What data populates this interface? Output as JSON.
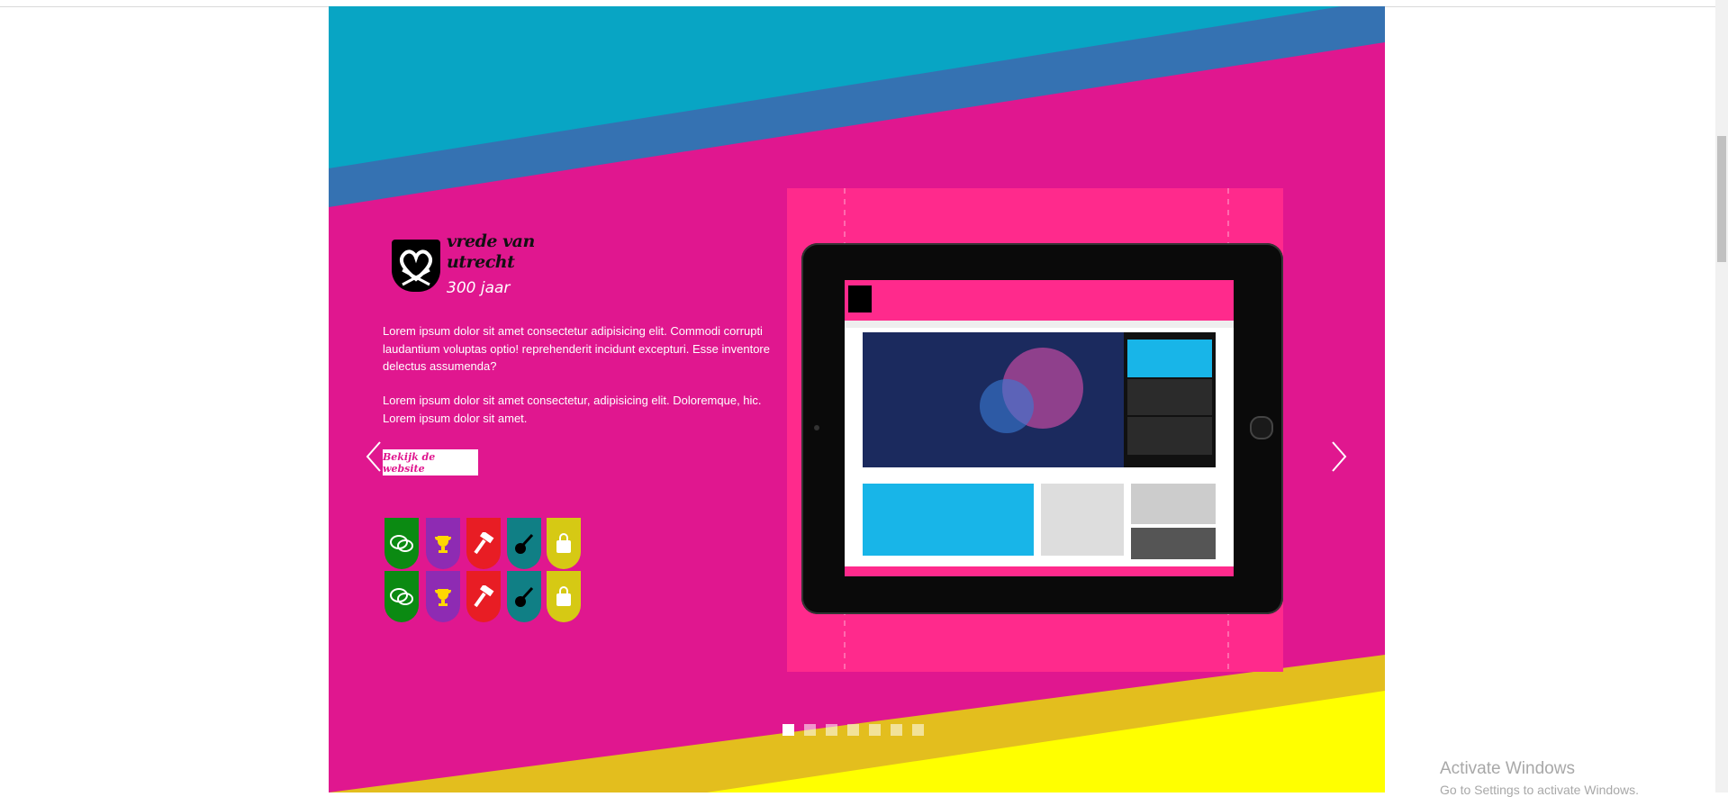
{
  "colors": {
    "magenta": "#e0178f",
    "cyan": "#08a5c4",
    "steel_blue": "#3572b2",
    "yellow": "#ffff00",
    "mustard": "#e3be1e",
    "device_pink": "#ff2a8c"
  },
  "project": {
    "logo_line1": "vrede van",
    "logo_line2": "utrecht",
    "logo_sub": "300 jaar",
    "paragraph1": "Lorem ipsum dolor sit amet consectetur adipisicing elit. Commodi corrupti laudantium voluptas optio! reprehenderit incidunt excepturi. Esse inventore delectus assumenda?",
    "paragraph2": "Lorem ipsum dolor sit amet consectetur, adipisicing elit. Doloremque, hic. Lorem ipsum dolor sit amet.",
    "cta_label": "Bekijk de website"
  },
  "badges": [
    {
      "icon": "chat-bubbles-icon",
      "color": "#0b8a12"
    },
    {
      "icon": "trophy-icon",
      "color": "#8e2bb3"
    },
    {
      "icon": "hammer-icon",
      "color": "#e81d24"
    },
    {
      "icon": "guitar-icon",
      "color": "#107f85"
    },
    {
      "icon": "shopping-bag-icon",
      "color": "#d6c914"
    },
    {
      "icon": "chat-bubbles-icon",
      "color": "#0b8a12"
    },
    {
      "icon": "trophy-icon",
      "color": "#8e2bb3"
    },
    {
      "icon": "hammer-icon",
      "color": "#e81d24"
    },
    {
      "icon": "guitar-icon",
      "color": "#107f85"
    },
    {
      "icon": "shopping-bag-icon",
      "color": "#d6c914"
    }
  ],
  "slider": {
    "total_slides": 7,
    "active_slide": 1
  },
  "watermark": {
    "line1": "Activate Windows",
    "line2": "Go to Settings to activate Windows."
  }
}
